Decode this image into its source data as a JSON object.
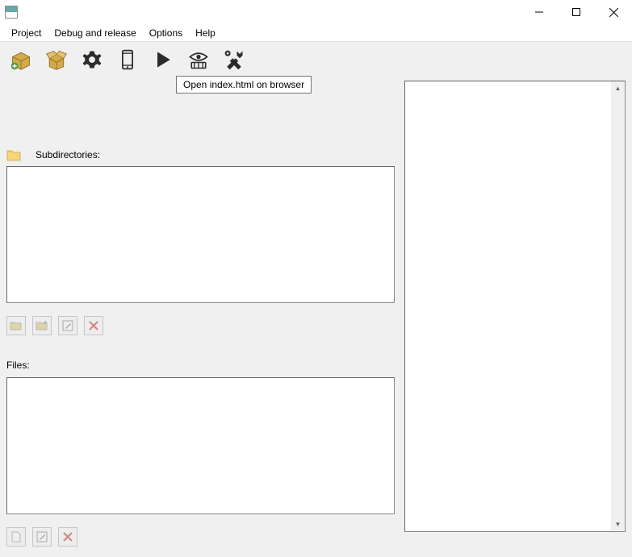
{
  "title": "",
  "menu": {
    "project": "Project",
    "debug": "Debug and release",
    "options": "Options",
    "help": "Help"
  },
  "toolbar": {
    "tooltip_open_browser": "Open index.html on browser"
  },
  "left": {
    "subdirs_label": "Subdirectories:",
    "files_label": "Files:"
  }
}
